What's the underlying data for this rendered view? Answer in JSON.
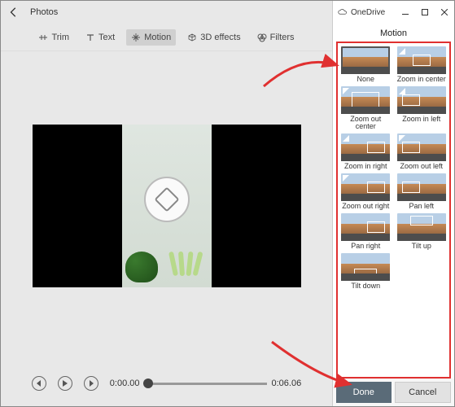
{
  "app_title": "Photos",
  "toolbar": {
    "trim": "Trim",
    "text": "Text",
    "motion": "Motion",
    "effects": "3D effects",
    "filters": "Filters"
  },
  "transport": {
    "current_time": "0:00.00",
    "total_time": "0:06.06"
  },
  "panel": {
    "service": "OneDrive",
    "title": "Motion",
    "items": [
      {
        "label": "None",
        "overlay": "ov-none",
        "selected": true,
        "arrow": ""
      },
      {
        "label": "Zoom in center",
        "overlay": "ov-center-sm",
        "arrow": "in"
      },
      {
        "label": "Zoom out center",
        "overlay": "ov-center-lg",
        "arrow": "out"
      },
      {
        "label": "Zoom in left",
        "overlay": "ov-left",
        "arrow": "in"
      },
      {
        "label": "Zoom in right",
        "overlay": "ov-right",
        "arrow": "in"
      },
      {
        "label": "Zoom out left",
        "overlay": "ov-left",
        "arrow": "out"
      },
      {
        "label": "Zoom out right",
        "overlay": "ov-right",
        "arrow": "out"
      },
      {
        "label": "Pan left",
        "overlay": "ov-left",
        "arrow": ""
      },
      {
        "label": "Pan right",
        "overlay": "ov-right",
        "arrow": ""
      },
      {
        "label": "Tilt up",
        "overlay": "ov-top",
        "arrow": ""
      },
      {
        "label": "Tilt down",
        "overlay": "ov-bottom",
        "arrow": ""
      }
    ],
    "done": "Done",
    "cancel": "Cancel"
  }
}
